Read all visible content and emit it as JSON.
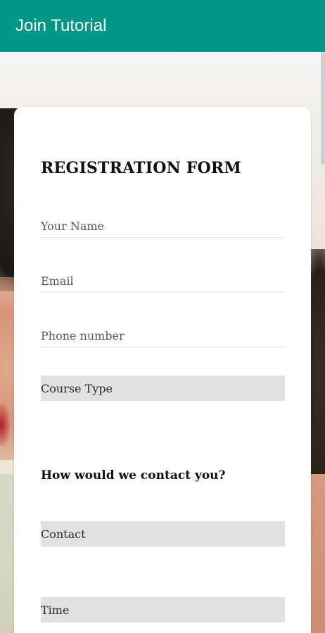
{
  "appbar": {
    "title": "Join Tutorial",
    "color": "#009688"
  },
  "form": {
    "title": "REGISTRATION FORM",
    "fields": {
      "name": {
        "placeholder": "Your Name"
      },
      "email": {
        "placeholder": "Email"
      },
      "phone": {
        "placeholder": "Phone number"
      }
    },
    "course_type": {
      "selected": "Course Type"
    },
    "contact_question": "How would we contact you?",
    "contact": {
      "selected": "Contact"
    },
    "time": {
      "selected": "Time"
    }
  }
}
